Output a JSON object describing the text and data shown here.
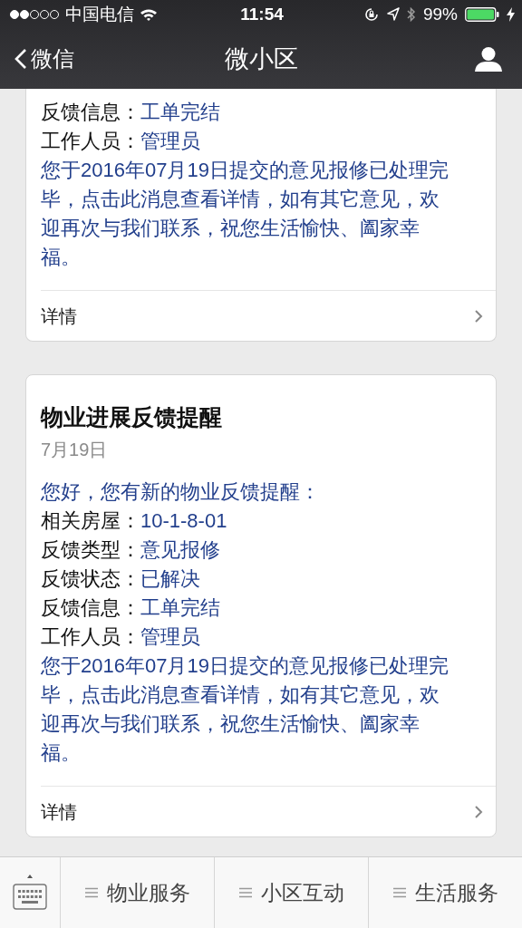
{
  "status_bar": {
    "carrier": "中国电信",
    "time": "11:54",
    "battery": "99%"
  },
  "nav_bar": {
    "back": "微信",
    "title": "微小区"
  },
  "cards": [
    {
      "fields": [
        {
          "label": "反馈信息：",
          "value": "工单完结"
        },
        {
          "label": "工作人员：",
          "value": "管理员"
        }
      ],
      "message": "您于2016年07月19日提交的意见报修已处理完毕，点击此消息查看详情，如有其它意见，欢迎再次与我们联系，祝您生活愉快、阖家幸福。",
      "link": "详情"
    },
    {
      "title": "物业进展反馈提醒",
      "date": "7月19日",
      "greeting": "您好，您有新的物业反馈提醒：",
      "fields": [
        {
          "label": "相关房屋：",
          "value": "10-1-8-01"
        },
        {
          "label": "反馈类型：",
          "value": "意见报修"
        },
        {
          "label": "反馈状态：",
          "value": "已解决"
        },
        {
          "label": "反馈信息：",
          "value": "工单完结"
        },
        {
          "label": "工作人员：",
          "value": "管理员"
        }
      ],
      "message": "您于2016年07月19日提交的意见报修已处理完毕，点击此消息查看详情，如有其它意见，欢迎再次与我们联系，祝您生活愉快、阖家幸福。",
      "link": "详情"
    }
  ],
  "menu": [
    "物业服务",
    "小区互动",
    "生活服务"
  ]
}
